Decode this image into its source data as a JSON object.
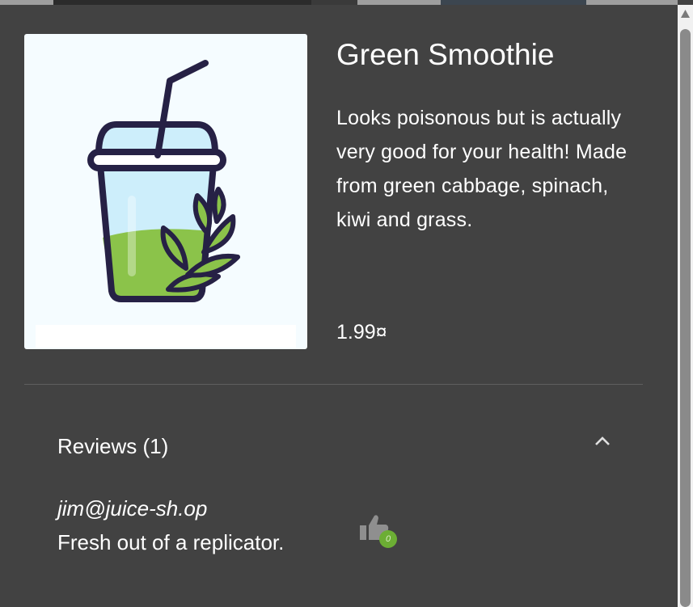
{
  "product": {
    "name": "Green Smoothie",
    "description": "Looks poisonous but is actually very good for your health! Made from green cabbage, spinach, kiwi and grass.",
    "price": "1.99¤",
    "image_icon": "green-smoothie-cup-icon"
  },
  "reviews": {
    "title": "Reviews (1)",
    "expanded": true,
    "items": [
      {
        "author": "jim@juice-sh.op",
        "message": "Fresh out of a replicator.",
        "likes": "0"
      }
    ]
  },
  "colors": {
    "panel_background": "#424242",
    "smoothie_green": "#8bc34a",
    "outline": "#262145",
    "like_badge": "#6cae34"
  },
  "icons": {
    "collapse": "chevron-up-icon",
    "like": "thumbs-up-icon"
  }
}
